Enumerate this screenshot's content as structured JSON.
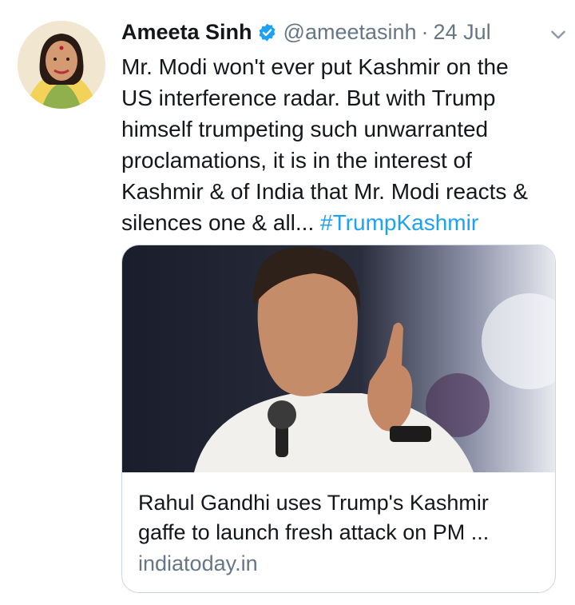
{
  "tweet": {
    "author_name": "Ameeta Sinh",
    "handle": "@ameetasinh",
    "separator": "·",
    "date": "24 Jul",
    "text_lines": [
      "Mr. Modi won't ever put Kashmir on the",
      "US interference radar. But with Trump",
      "himself trumpeting such unwarranted",
      "proclamations, it is in the interest of",
      "Kashmir & of India that Mr. Modi reacts &",
      "silences one & all... "
    ],
    "hashtag": "#TrumpKashmir"
  },
  "card": {
    "title_line1": "Rahul Gandhi uses Trump's Kashmir",
    "title_line2": "gaffe to launch fresh attack on PM ...",
    "domain": "indiatoday.in"
  },
  "icons": {
    "verified": "verified-badge-icon",
    "menu": "chevron-down-icon"
  },
  "colors": {
    "link": "#1da1f2",
    "secondary_text": "#657786",
    "border": "#ccd6dd"
  }
}
